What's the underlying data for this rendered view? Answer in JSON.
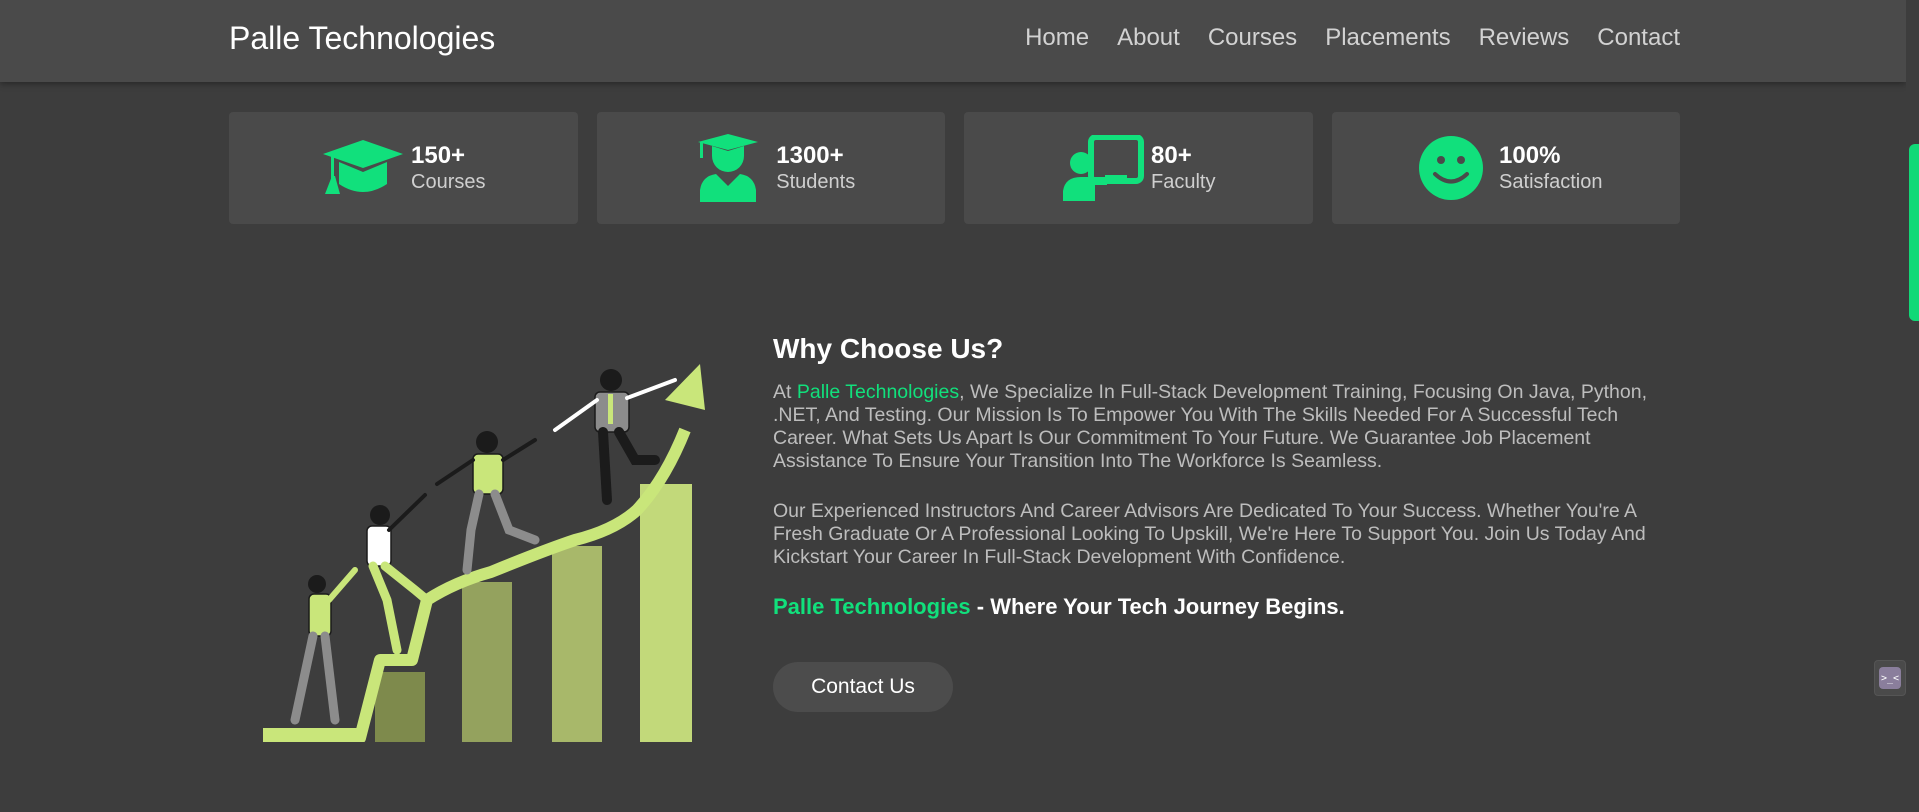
{
  "navbar": {
    "brand": "Palle Technologies",
    "links": [
      "Home",
      "About",
      "Courses",
      "Placements",
      "Reviews",
      "Contact"
    ]
  },
  "stats": [
    {
      "value": "150+",
      "label": "Courses",
      "icon": "graduation-cap-icon"
    },
    {
      "value": "1300+",
      "label": "Students",
      "icon": "student-icon"
    },
    {
      "value": "80+",
      "label": "Faculty",
      "icon": "teacher-board-icon"
    },
    {
      "value": "100%",
      "label": "Satisfaction",
      "icon": "smiley-icon"
    }
  ],
  "why": {
    "title": "Why Choose Us?",
    "para1_prefix": "At ",
    "para1_brand": "Palle Technologies",
    "para1_rest": ", We Specialize In Full-Stack Development Training, Focusing On Java, Python, .NET, And Testing. Our Mission Is To Empower You With The Skills Needed For A Successful Tech Career. What Sets Us Apart Is Our Commitment To Your Future. We Guarantee Job Placement Assistance To Ensure Your Transition Into The Workforce Is Seamless.",
    "para2": "Our Experienced Instructors And Career Advisors Are Dedicated To Your Success. Whether You're A Fresh Graduate Or A Professional Looking To Upskill, We're Here To Support You. Join Us Today And Kickstart Your Career In Full-Stack Development With Confidence.",
    "tagline_brand": "Palle Technologies",
    "tagline_rest": " - Where Your Tech Journey Begins.",
    "button": "Contact Us"
  },
  "colors": {
    "accent": "#11e07c",
    "background": "#3d3d3d",
    "card": "#4a4a4a",
    "illustration_green": "#c2d97a"
  },
  "chat_widget": {
    "icon": "chat-bot-icon",
    "text": ">_<"
  }
}
